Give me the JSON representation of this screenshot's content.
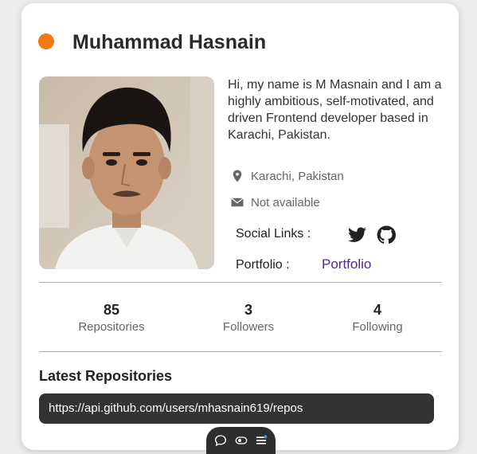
{
  "colors": {
    "status_dot": "#f47a0f",
    "link": "#4b2a8c",
    "repo_bg": "#333333"
  },
  "profile": {
    "name": "Muhammad Hasnain",
    "bio": "Hi, my name is M Masnain and I am a highly ambitious, self-motivated, and driven Frontend developer based in Karachi, Pakistan.",
    "location": "Karachi, Pakistan",
    "email": "Not available",
    "location_icon": "map-pin-icon",
    "email_icon": "envelope-icon"
  },
  "social": {
    "label": "Social Links :",
    "icons": [
      "twitter-icon",
      "github-icon"
    ]
  },
  "portfolio": {
    "label": "Portfolio :",
    "link_text": "Portfolio"
  },
  "stats": [
    {
      "value": "85",
      "label": "Repositories"
    },
    {
      "value": "3",
      "label": "Followers"
    },
    {
      "value": "4",
      "label": "Following"
    }
  ],
  "repos": {
    "title": "Latest Repositories",
    "url": "https://api.github.com/users/mhasnain619/repos"
  },
  "toolbar": {
    "icons": [
      "comment-icon",
      "toggle-icon",
      "menu-list-icon"
    ]
  }
}
